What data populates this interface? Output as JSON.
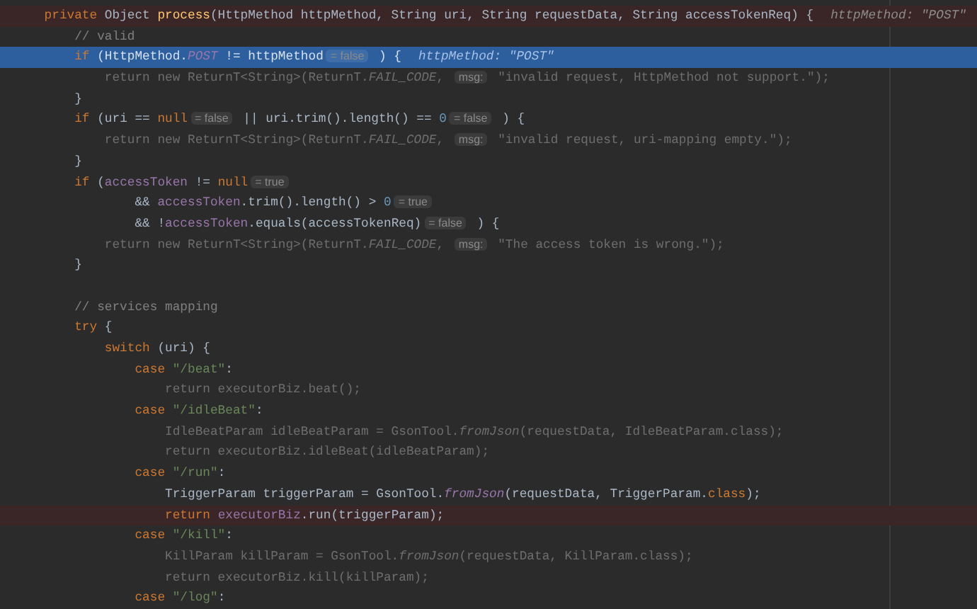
{
  "editor": {
    "lines": [
      {
        "kind": "code",
        "breakpoint": true,
        "current": false,
        "dimmed": false,
        "tokens": [
          {
            "kind": "keyword",
            "text": "    private "
          },
          {
            "kind": "text",
            "text": "Object "
          },
          {
            "kind": "method",
            "text": "process"
          },
          {
            "kind": "text",
            "text": "(HttpMethod httpMethod, String uri, String requestData, String accessTokenReq) {"
          },
          {
            "kind": "inline_value",
            "text": "httpMethod: \"POST\""
          }
        ]
      },
      {
        "kind": "code",
        "breakpoint": false,
        "current": false,
        "dimmed": false,
        "tokens": [
          {
            "kind": "comment",
            "text": "        // valid"
          }
        ]
      },
      {
        "kind": "code",
        "breakpoint": false,
        "current": true,
        "dimmed": false,
        "tokens": [
          {
            "kind": "keyword",
            "text": "        if "
          },
          {
            "kind": "text",
            "text": "(HttpMethod."
          },
          {
            "kind": "static",
            "text": "POST"
          },
          {
            "kind": "text",
            "text": " != httpMethod"
          },
          {
            "kind": "value_hint",
            "text": "= false"
          },
          {
            "kind": "text",
            "text": " ) {"
          },
          {
            "kind": "inline_value",
            "text": "httpMethod: \"POST\""
          }
        ]
      },
      {
        "kind": "code",
        "breakpoint": false,
        "current": false,
        "dimmed": true,
        "tokens": [
          {
            "kind": "text",
            "text": "            return new ReturnT<String>(ReturnT."
          },
          {
            "kind": "static",
            "text": "FAIL_CODE"
          },
          {
            "kind": "text",
            "text": ", "
          },
          {
            "kind": "param_hint",
            "text": "msg:"
          },
          {
            "kind": "text",
            "text": " \"invalid request, HttpMethod not support.\");"
          }
        ]
      },
      {
        "kind": "code",
        "breakpoint": false,
        "current": false,
        "dimmed": false,
        "tokens": [
          {
            "kind": "text",
            "text": "        }"
          }
        ]
      },
      {
        "kind": "code",
        "breakpoint": false,
        "current": false,
        "dimmed": false,
        "tokens": [
          {
            "kind": "keyword",
            "text": "        if "
          },
          {
            "kind": "text",
            "text": "(uri == "
          },
          {
            "kind": "keyword",
            "text": "null"
          },
          {
            "kind": "value_hint",
            "text": "= false"
          },
          {
            "kind": "text",
            "text": " || uri.trim().length() == "
          },
          {
            "kind": "number",
            "text": "0"
          },
          {
            "kind": "value_hint",
            "text": "= false"
          },
          {
            "kind": "text",
            "text": " ) {"
          }
        ]
      },
      {
        "kind": "code",
        "breakpoint": false,
        "current": false,
        "dimmed": true,
        "tokens": [
          {
            "kind": "text",
            "text": "            return new ReturnT<String>(ReturnT."
          },
          {
            "kind": "static",
            "text": "FAIL_CODE"
          },
          {
            "kind": "text",
            "text": ", "
          },
          {
            "kind": "param_hint",
            "text": "msg:"
          },
          {
            "kind": "text",
            "text": " \"invalid request, uri-mapping empty.\");"
          }
        ]
      },
      {
        "kind": "code",
        "breakpoint": false,
        "current": false,
        "dimmed": false,
        "tokens": [
          {
            "kind": "text",
            "text": "        }"
          }
        ]
      },
      {
        "kind": "code",
        "breakpoint": false,
        "current": false,
        "dimmed": false,
        "tokens": [
          {
            "kind": "keyword",
            "text": "        if "
          },
          {
            "kind": "text",
            "text": "("
          },
          {
            "kind": "field",
            "text": "accessToken"
          },
          {
            "kind": "text",
            "text": " != "
          },
          {
            "kind": "keyword",
            "text": "null"
          },
          {
            "kind": "value_hint",
            "text": "= true"
          }
        ]
      },
      {
        "kind": "code",
        "breakpoint": false,
        "current": false,
        "dimmed": false,
        "tokens": [
          {
            "kind": "text",
            "text": "                && "
          },
          {
            "kind": "field",
            "text": "accessToken"
          },
          {
            "kind": "text",
            "text": ".trim().length() > "
          },
          {
            "kind": "number",
            "text": "0"
          },
          {
            "kind": "value_hint",
            "text": "= true"
          }
        ]
      },
      {
        "kind": "code",
        "breakpoint": false,
        "current": false,
        "dimmed": false,
        "tokens": [
          {
            "kind": "text",
            "text": "                && !"
          },
          {
            "kind": "field",
            "text": "accessToken"
          },
          {
            "kind": "text",
            "text": ".equals(accessTokenReq)"
          },
          {
            "kind": "value_hint",
            "text": "= false"
          },
          {
            "kind": "text",
            "text": " ) {"
          }
        ]
      },
      {
        "kind": "code",
        "breakpoint": false,
        "current": false,
        "dimmed": true,
        "tokens": [
          {
            "kind": "text",
            "text": "            return new ReturnT<String>(ReturnT."
          },
          {
            "kind": "static",
            "text": "FAIL_CODE"
          },
          {
            "kind": "text",
            "text": ", "
          },
          {
            "kind": "param_hint",
            "text": "msg:"
          },
          {
            "kind": "text",
            "text": " \"The access token is wrong.\");"
          }
        ]
      },
      {
        "kind": "code",
        "breakpoint": false,
        "current": false,
        "dimmed": false,
        "tokens": [
          {
            "kind": "text",
            "text": "        }"
          }
        ]
      },
      {
        "kind": "blank"
      },
      {
        "kind": "code",
        "breakpoint": false,
        "current": false,
        "dimmed": false,
        "tokens": [
          {
            "kind": "comment",
            "text": "        // services mapping"
          }
        ]
      },
      {
        "kind": "code",
        "breakpoint": false,
        "current": false,
        "dimmed": false,
        "tokens": [
          {
            "kind": "keyword",
            "text": "        try "
          },
          {
            "kind": "text",
            "text": "{"
          }
        ]
      },
      {
        "kind": "code",
        "breakpoint": false,
        "current": false,
        "dimmed": false,
        "tokens": [
          {
            "kind": "keyword",
            "text": "            switch "
          },
          {
            "kind": "text",
            "text": "(uri) {"
          }
        ]
      },
      {
        "kind": "code",
        "breakpoint": false,
        "current": false,
        "dimmed": false,
        "tokens": [
          {
            "kind": "keyword",
            "text": "                case "
          },
          {
            "kind": "string",
            "text": "\"/beat\""
          },
          {
            "kind": "text",
            "text": ":"
          }
        ]
      },
      {
        "kind": "code",
        "breakpoint": false,
        "current": false,
        "dimmed": true,
        "tokens": [
          {
            "kind": "text",
            "text": "                    return executorBiz.beat();"
          }
        ]
      },
      {
        "kind": "code",
        "breakpoint": false,
        "current": false,
        "dimmed": false,
        "tokens": [
          {
            "kind": "keyword",
            "text": "                case "
          },
          {
            "kind": "string",
            "text": "\"/idleBeat\""
          },
          {
            "kind": "text",
            "text": ":"
          }
        ]
      },
      {
        "kind": "code",
        "breakpoint": false,
        "current": false,
        "dimmed": true,
        "tokens": [
          {
            "kind": "text",
            "text": "                    IdleBeatParam idleBeatParam = GsonTool."
          },
          {
            "kind": "static",
            "text": "fromJson"
          },
          {
            "kind": "text",
            "text": "(requestData, IdleBeatParam.class);"
          }
        ]
      },
      {
        "kind": "code",
        "breakpoint": false,
        "current": false,
        "dimmed": true,
        "tokens": [
          {
            "kind": "text",
            "text": "                    return executorBiz.idleBeat(idleBeatParam);"
          }
        ]
      },
      {
        "kind": "code",
        "breakpoint": false,
        "current": false,
        "dimmed": false,
        "tokens": [
          {
            "kind": "keyword",
            "text": "                case "
          },
          {
            "kind": "string",
            "text": "\"/run\""
          },
          {
            "kind": "text",
            "text": ":"
          }
        ]
      },
      {
        "kind": "code",
        "breakpoint": false,
        "current": false,
        "dimmed": false,
        "tokens": [
          {
            "kind": "text",
            "text": "                    TriggerParam triggerParam = GsonTool."
          },
          {
            "kind": "static",
            "text": "fromJson"
          },
          {
            "kind": "text",
            "text": "(requestData, TriggerParam."
          },
          {
            "kind": "keyword",
            "text": "class"
          },
          {
            "kind": "text",
            "text": ");"
          }
        ]
      },
      {
        "kind": "code",
        "breakpoint": true,
        "current": false,
        "dimmed": false,
        "tokens": [
          {
            "kind": "keyword",
            "text": "                    return "
          },
          {
            "kind": "field",
            "text": "executorBiz"
          },
          {
            "kind": "text",
            "text": ".run(triggerParam);"
          }
        ]
      },
      {
        "kind": "code",
        "breakpoint": false,
        "current": false,
        "dimmed": false,
        "tokens": [
          {
            "kind": "keyword",
            "text": "                case "
          },
          {
            "kind": "string",
            "text": "\"/kill\""
          },
          {
            "kind": "text",
            "text": ":"
          }
        ]
      },
      {
        "kind": "code",
        "breakpoint": false,
        "current": false,
        "dimmed": true,
        "tokens": [
          {
            "kind": "text",
            "text": "                    KillParam killParam = GsonTool."
          },
          {
            "kind": "static",
            "text": "fromJson"
          },
          {
            "kind": "text",
            "text": "(requestData, KillParam.class);"
          }
        ]
      },
      {
        "kind": "code",
        "breakpoint": false,
        "current": false,
        "dimmed": true,
        "tokens": [
          {
            "kind": "text",
            "text": "                    return executorBiz.kill(killParam);"
          }
        ]
      },
      {
        "kind": "code",
        "breakpoint": false,
        "current": false,
        "dimmed": false,
        "tokens": [
          {
            "kind": "keyword",
            "text": "                case "
          },
          {
            "kind": "string",
            "text": "\"/log\""
          },
          {
            "kind": "text",
            "text": ":"
          }
        ]
      }
    ]
  }
}
